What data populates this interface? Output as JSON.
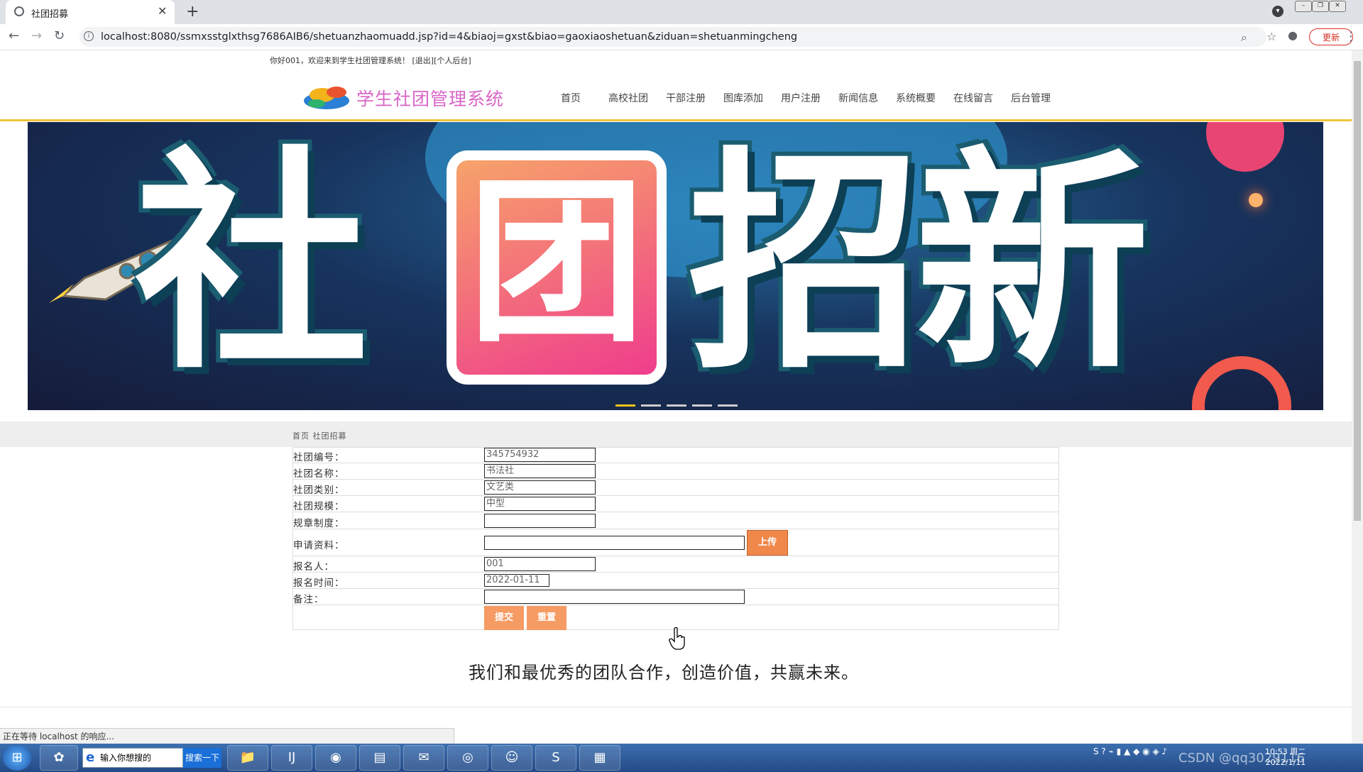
{
  "browser": {
    "tab_title": "社团招募",
    "url": "localhost:8080/ssmxsstglxthsg7686AIB6/shetuanzhaomuadd.jsp?id=4&biaoj=gxst&biao=gaoxiaoshetuan&ziduan=shetuanmingcheng",
    "update_label": "更新",
    "status_text": "正在等待 localhost 的响应..."
  },
  "header": {
    "welcome": "你好001，欢迎来到学生社团管理系统！ [退出][个人后台]",
    "site_name": "学生社团管理系统",
    "nav": [
      "首页",
      "高校社团",
      "干部注册",
      "图库添加",
      "用户注册",
      "新闻信息",
      "系统概要",
      "在线留言",
      "后台管理"
    ]
  },
  "banner": {
    "text_left": "社",
    "text_box": "团",
    "text_right": "招新",
    "active_slide": 1,
    "slide_count": 5
  },
  "breadcrumb": "首页 社团招募",
  "form": {
    "fields": [
      {
        "label": "社团编号：",
        "value": "345754932"
      },
      {
        "label": "社团名称：",
        "value": "书法社"
      },
      {
        "label": "社团类别：",
        "value": "文艺类"
      },
      {
        "label": "社团规模：",
        "value": "中型"
      },
      {
        "label": "规章制度：",
        "value": ""
      },
      {
        "label": "申请资料：",
        "value": ""
      },
      {
        "label": "报名人：",
        "value": "001"
      },
      {
        "label": "报名时间：",
        "value": "2022-01-11"
      },
      {
        "label": "备注：",
        "value": ""
      }
    ],
    "upload_label": "上传",
    "submit_label": "提交",
    "reset_label": "重置"
  },
  "slogan": "我们和最优秀的团队合作，创造价值，共赢未来。",
  "taskbar": {
    "search_placeholder": "输入你想搜的",
    "search_button": "搜索一下",
    "tray_text": "CSDN @qq3029116",
    "clock_time": "10:53 周二",
    "clock_date": "2022/1/11"
  },
  "colors": {
    "accent_orange": "#f0874b",
    "site_name_pink": "#d966c8",
    "nav_underline": "#f2c33b"
  }
}
